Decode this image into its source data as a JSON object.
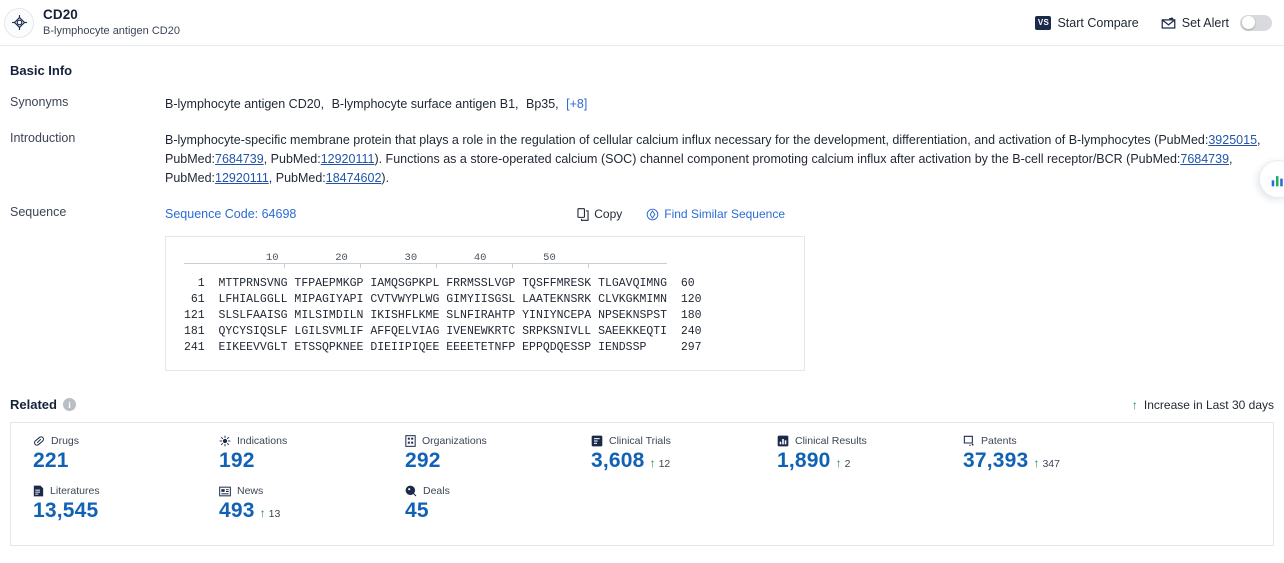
{
  "header": {
    "logo_icon": "target-icon",
    "title": "CD20",
    "subtitle": "B-lymphocyte antigen CD20",
    "compare_badge": "VS",
    "compare_label": "Start Compare",
    "alert_icon": "alert-bell-icon",
    "alert_label": "Set Alert",
    "alert_toggle_on": false
  },
  "basic_info": {
    "section_title": "Basic Info",
    "synonyms_label": "Synonyms",
    "synonyms": [
      "B-lymphocyte antigen CD20,",
      "B-lymphocyte surface antigen B1,",
      "Bp35,"
    ],
    "synonyms_more": "[+8]",
    "introduction_label": "Introduction",
    "introduction_parts": [
      {
        "type": "text",
        "text": "B-lymphocyte-specific membrane protein that plays a role in the regulation of cellular calcium influx necessary for the development, differentiation, and activation of B-lymphocytes (PubMed:"
      },
      {
        "type": "link",
        "text": "3925015"
      },
      {
        "type": "text",
        "text": ", PubMed:"
      },
      {
        "type": "link",
        "text": "7684739"
      },
      {
        "type": "text",
        "text": ", PubMed:"
      },
      {
        "type": "link",
        "text": "12920111"
      },
      {
        "type": "text",
        "text": "). Functions as a store-operated calcium (SOC) channel component promoting calcium influx after activation by the B-cell receptor/BCR (PubMed:"
      },
      {
        "type": "link",
        "text": "7684739"
      },
      {
        "type": "text",
        "text": ", PubMed:"
      },
      {
        "type": "link",
        "text": "12920111"
      },
      {
        "type": "text",
        "text": ", PubMed:"
      },
      {
        "type": "link",
        "text": "18474602"
      },
      {
        "type": "text",
        "text": ")."
      }
    ]
  },
  "sequence": {
    "label": "Sequence",
    "code_text": "Sequence Code: 64698",
    "copy_label": "Copy",
    "copy_icon": "copy-icon",
    "find_label": "Find Similar Sequence",
    "find_icon": "find-similar-icon",
    "ruler_ticks": [
      10,
      20,
      30,
      40,
      50
    ],
    "rows": [
      {
        "start": "1",
        "blocks": [
          "MTTPRNSVNG",
          "TFPAEPMKGP",
          "IAMQSGPKPL",
          "FRRMSSLVGP",
          "TQSFFMRESK",
          "TLGAVQIMNG"
        ],
        "end": "60"
      },
      {
        "start": "61",
        "blocks": [
          "LFHIALGGLL",
          "MIPAGIYAPI",
          "CVTVWYPLWG",
          "GIMYIISGSL",
          "LAATEKNSRK",
          "CLVKGKMIMN"
        ],
        "end": "120"
      },
      {
        "start": "121",
        "blocks": [
          "SLSLFAAISG",
          "MILSIMDILN",
          "IKISHFLKME",
          "SLNFIRAHTP",
          "YINIYNCEPA",
          "NPSEKNSPST"
        ],
        "end": "180"
      },
      {
        "start": "181",
        "blocks": [
          "QYCYSIQSLF",
          "LGILSVMLIF",
          "AFFQELVIAG",
          "IVENEWKRTC",
          "SRPKSNIVLL",
          "SAEEKKEQTI"
        ],
        "end": "240"
      },
      {
        "start": "241",
        "blocks": [
          "EIKEEVVGLT",
          "ETSSQPKNEE",
          "DIEIIPIQEE",
          "EEEETETNFP",
          "EPPQDQESSP",
          "IENDSSP"
        ],
        "end": "297"
      }
    ]
  },
  "related": {
    "title": "Related",
    "info_icon": "info-icon",
    "legend_arrow": "arrow-up-icon",
    "legend_text": "Increase in Last 30 days",
    "metrics": [
      {
        "icon": "pill-icon",
        "label": "Drugs",
        "value": "221",
        "delta": ""
      },
      {
        "icon": "virus-icon",
        "label": "Indications",
        "value": "192",
        "delta": ""
      },
      {
        "icon": "building-icon",
        "label": "Organizations",
        "value": "292",
        "delta": ""
      },
      {
        "icon": "clinical-trial-icon",
        "label": "Clinical Trials",
        "value": "3,608",
        "delta": "12"
      },
      {
        "icon": "clinical-result-icon",
        "label": "Clinical Results",
        "value": "1,890",
        "delta": "2"
      },
      {
        "icon": "patent-icon",
        "label": "Patents",
        "value": "37,393",
        "delta": "347"
      },
      {
        "icon": "literature-icon",
        "label": "Literatures",
        "value": "13,545",
        "delta": ""
      },
      {
        "icon": "news-icon",
        "label": "News",
        "value": "493",
        "delta": "13"
      },
      {
        "icon": "deal-icon",
        "label": "Deals",
        "value": "45",
        "delta": ""
      }
    ]
  },
  "float_widget": {
    "icon": "bar-chart-icon"
  },
  "colors": {
    "accent_blue": "#1161b5",
    "link_blue": "#2b6cd4",
    "pubmed_link": "#2255aa",
    "green": "#1e8a3c",
    "dark_navy": "#16223a"
  }
}
